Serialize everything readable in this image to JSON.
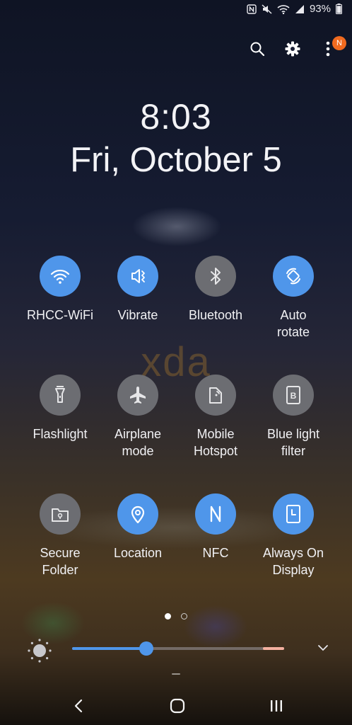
{
  "status_bar": {
    "nfc_icon": "nfc-icon",
    "mute_icon": "mute-icon",
    "wifi_icon": "wifi-icon",
    "signal_icon": "signal-icon",
    "battery_percent": "93%",
    "battery_level": 0.93
  },
  "header": {
    "search_icon": "search-icon",
    "settings_icon": "gear-icon",
    "more_icon": "more-vertical-icon",
    "notification_badge": "N"
  },
  "clock": {
    "time": "8:03",
    "date": "Fri, October 5"
  },
  "watermark": "xda",
  "quick_settings": [
    {
      "label": "RHCC-WiFi",
      "icon": "wifi-icon",
      "state": "on"
    },
    {
      "label": "Vibrate",
      "icon": "vibrate-icon",
      "state": "on"
    },
    {
      "label": "Bluetooth",
      "icon": "bluetooth-icon",
      "state": "off"
    },
    {
      "label": "Auto\nrotate",
      "icon": "auto-rotate-icon",
      "state": "on"
    },
    {
      "label": "Flashlight",
      "icon": "flashlight-icon",
      "state": "off"
    },
    {
      "label": "Airplane\nmode",
      "icon": "airplane-icon",
      "state": "off"
    },
    {
      "label": "Mobile\nHotspot",
      "icon": "hotspot-icon",
      "state": "off"
    },
    {
      "label": "Blue light\nfilter",
      "icon": "blue-light-icon",
      "state": "off"
    },
    {
      "label": "Secure\nFolder",
      "icon": "secure-folder-icon",
      "state": "off"
    },
    {
      "label": "Location",
      "icon": "location-icon",
      "state": "on"
    },
    {
      "label": "NFC",
      "icon": "nfc-icon",
      "state": "on"
    },
    {
      "label": "Always On\nDisplay",
      "icon": "always-on-display-icon",
      "state": "on"
    }
  ],
  "pager": {
    "pages": 2,
    "current": 1
  },
  "brightness": {
    "level": 0.35,
    "sun_icon": "brightness-icon",
    "expand_icon": "chevron-down-icon"
  },
  "navigation": {
    "back_icon": "back-icon",
    "home_icon": "home-icon",
    "recents_icon": "recents-icon"
  },
  "colors": {
    "accent": "#4f96ea",
    "tile_off": "#6c6d72",
    "badge": "#f06a1f"
  }
}
